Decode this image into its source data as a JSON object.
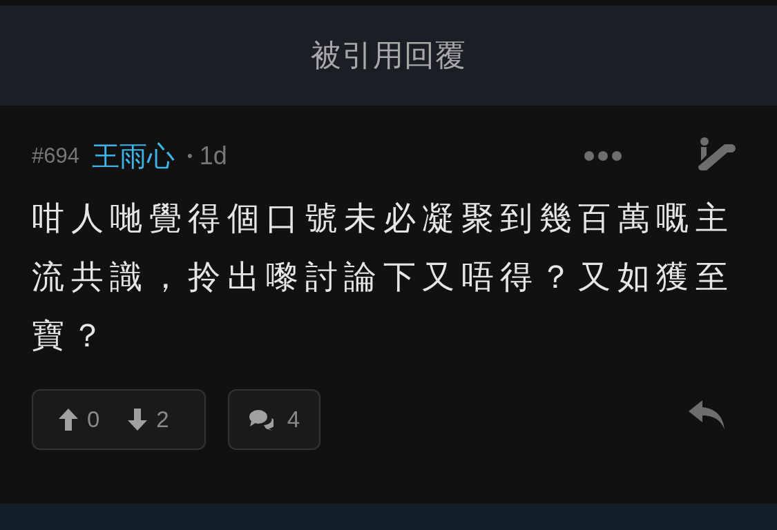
{
  "header": {
    "title": "被引用回覆"
  },
  "post": {
    "number": "#694",
    "author": "王雨心",
    "separator": "•",
    "age": "1d",
    "body": "咁人哋覺得個口號未必凝聚到幾百萬嘅主流共識，拎出嚟討論下又唔得？又如獲至寶？"
  },
  "actions": {
    "upvotes": "0",
    "downvotes": "2",
    "comments": "4"
  }
}
